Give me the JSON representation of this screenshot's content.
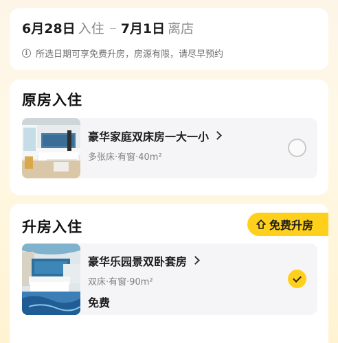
{
  "dates": {
    "checkin": "6月28日",
    "checkin_label": "入住",
    "checkout": "7月1日",
    "checkout_label": "离店",
    "notice": "所选日期可享免费升房，房源有限，请尽早预约"
  },
  "original_section": {
    "title": "原房入住",
    "room": {
      "name": "豪华家庭双床房一大一小",
      "meta": "多张床·有窗·40m²",
      "selected": false
    }
  },
  "upgrade_section": {
    "title": "升房入住",
    "badge": "免费升房",
    "room": {
      "name": "豪华乐园景双卧套房",
      "meta": "双床·有窗·90m²",
      "price": "免费",
      "selected": true
    }
  },
  "colors": {
    "accent": "#ffd01b",
    "card_bg": "#f5f5f7",
    "muted_text": "#808080"
  }
}
